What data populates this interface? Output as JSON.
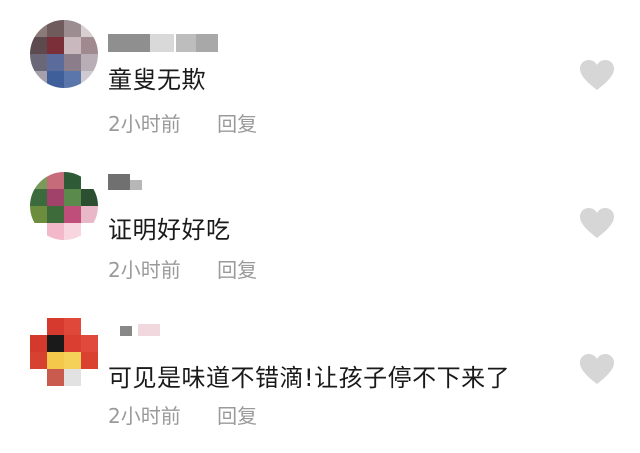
{
  "comments": [
    {
      "username": "",
      "text": "童叟无欺",
      "time": "2小时前",
      "reply_label": "回复",
      "like_icon": "heart-icon"
    },
    {
      "username": "",
      "text": "证明好好吃",
      "time": "2小时前",
      "reply_label": "回复",
      "like_icon": "heart-icon"
    },
    {
      "username": "",
      "text": "可见是味道不错滴!让孩子停不下来了",
      "time": "2小时前",
      "reply_label": "回复",
      "like_icon": "heart-icon"
    }
  ],
  "colors": {
    "text": "#1a1a1a",
    "meta": "#9a9a9a",
    "heart": "#d6d6d6",
    "background": "#ffffff"
  }
}
